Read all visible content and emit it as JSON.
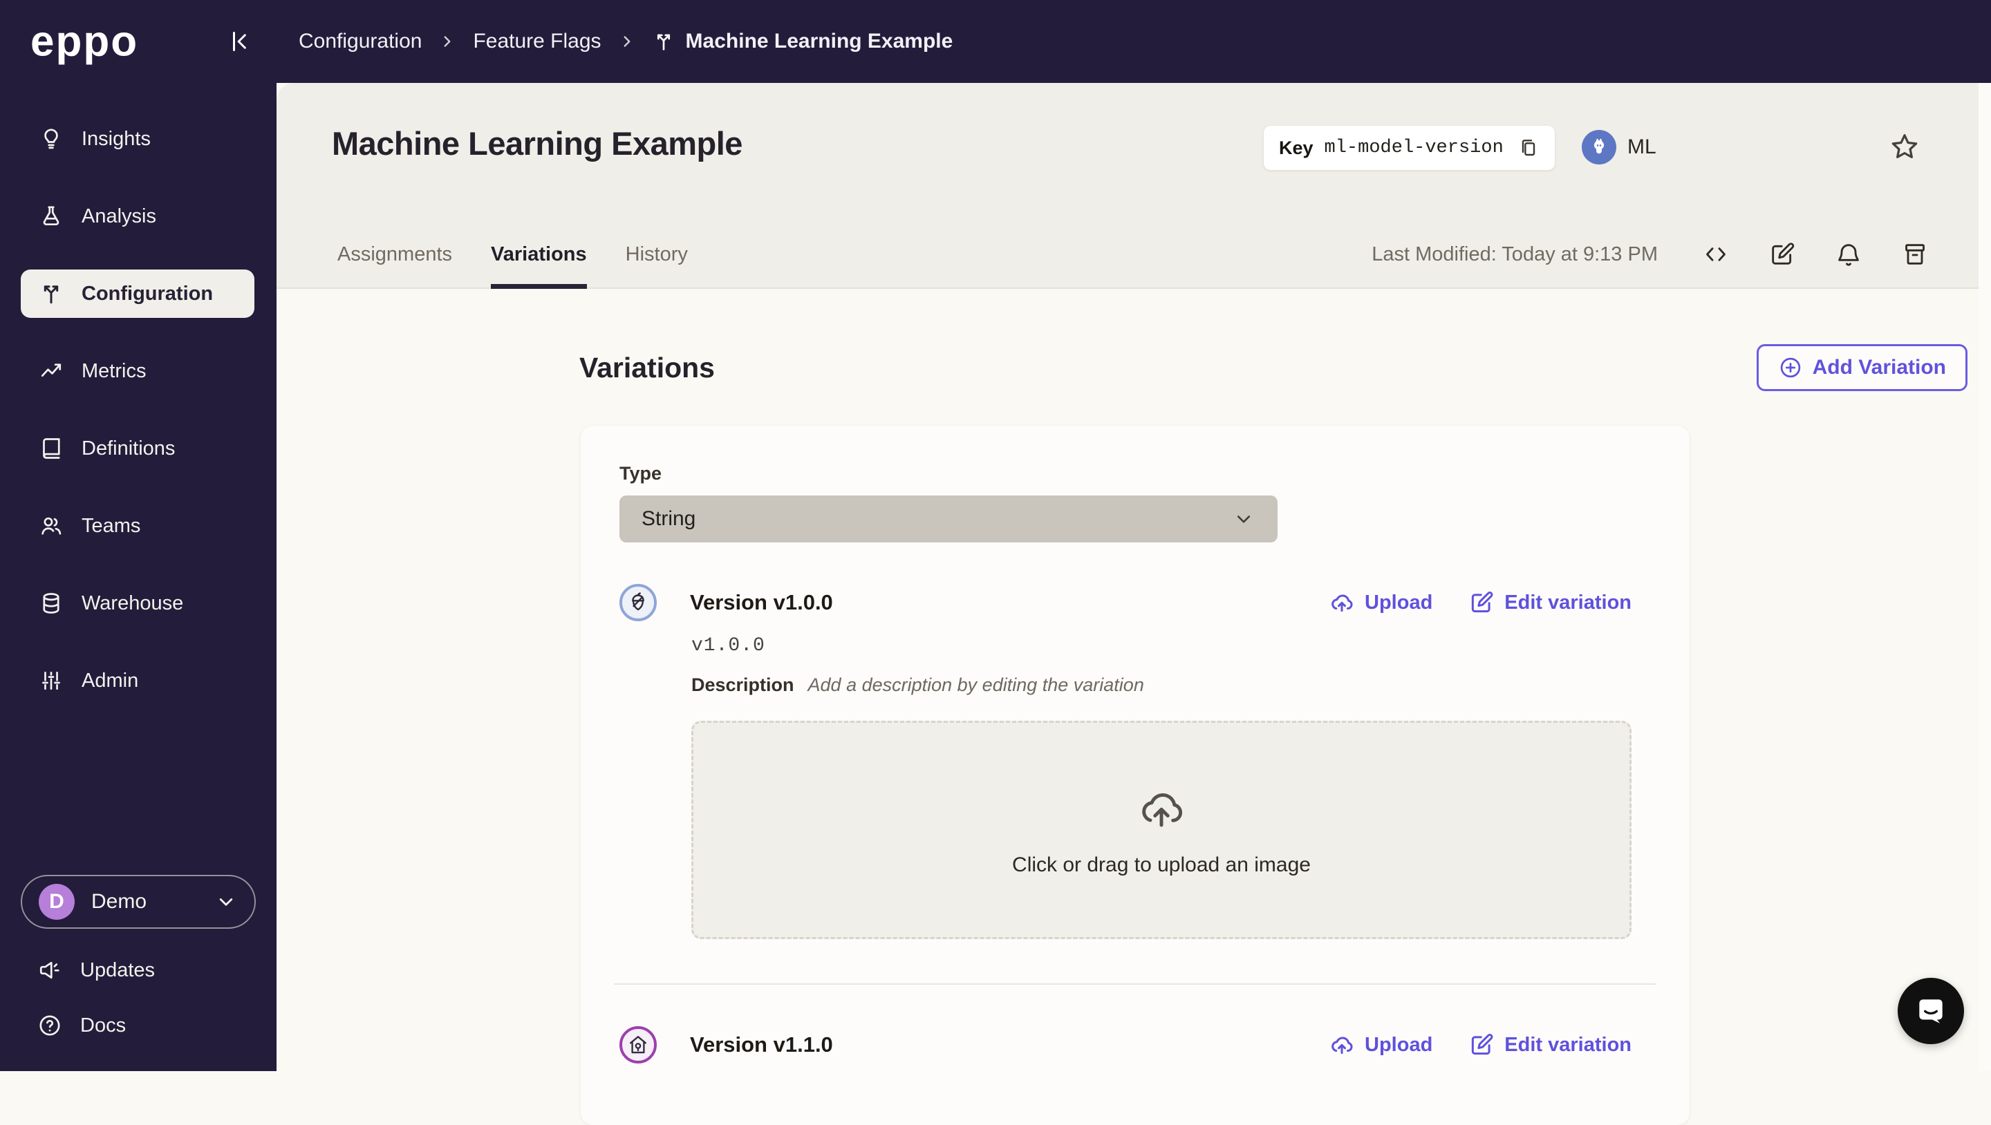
{
  "topbar": {
    "logo": "eppo",
    "breadcrumb": {
      "items": [
        "Configuration",
        "Feature Flags",
        "Machine Learning Example"
      ]
    }
  },
  "sidebar": {
    "items": [
      {
        "label": "Insights",
        "icon": "lightbulb-icon"
      },
      {
        "label": "Analysis",
        "icon": "flask-icon"
      },
      {
        "label": "Configuration",
        "icon": "split-arrows-icon",
        "active": true
      },
      {
        "label": "Metrics",
        "icon": "chart-line-icon"
      },
      {
        "label": "Definitions",
        "icon": "book-icon"
      },
      {
        "label": "Teams",
        "icon": "people-icon"
      },
      {
        "label": "Warehouse",
        "icon": "database-icon"
      },
      {
        "label": "Admin",
        "icon": "sliders-icon"
      }
    ],
    "account": {
      "name": "Demo",
      "initial": "D"
    },
    "footer": [
      {
        "label": "Updates",
        "icon": "megaphone-icon"
      },
      {
        "label": "Docs",
        "icon": "help-circle-icon"
      }
    ]
  },
  "header": {
    "title": "Machine Learning Example",
    "key_label": "Key",
    "key_value": "ml-model-version",
    "owner_initials": "ML",
    "tabs": [
      {
        "label": "Assignments"
      },
      {
        "label": "Variations",
        "active": true
      },
      {
        "label": "History"
      }
    ],
    "last_modified": "Last Modified: Today at 9:13 PM"
  },
  "variations": {
    "heading": "Variations",
    "add_button": "Add Variation",
    "type_label": "Type",
    "type_value": "String",
    "upload_label": "Upload",
    "edit_label": "Edit variation",
    "description_label": "Description",
    "description_placeholder": "Add a description by editing the variation",
    "dropzone_text": "Click or drag to upload an image",
    "items": [
      {
        "name": "Version v1.0.0",
        "value": "v1.0.0",
        "avatar": "acorn-icon"
      },
      {
        "name": "Version v1.1.0",
        "avatar": "birdhouse-icon"
      }
    ]
  },
  "colors": {
    "sidebar_bg": "#231c3a",
    "accent_purple": "#6052dd",
    "header_beige": "#f0eee8",
    "page_bg": "#faf9f4",
    "card_bg": "#fdfcfa",
    "select_bg": "#c9c5bc",
    "owner_avatar_blue": "#5d77c4",
    "account_avatar_purple": "#b67fda",
    "variation1_ring": "#8fa5d8",
    "variation2_ring": "#9d3fae"
  }
}
